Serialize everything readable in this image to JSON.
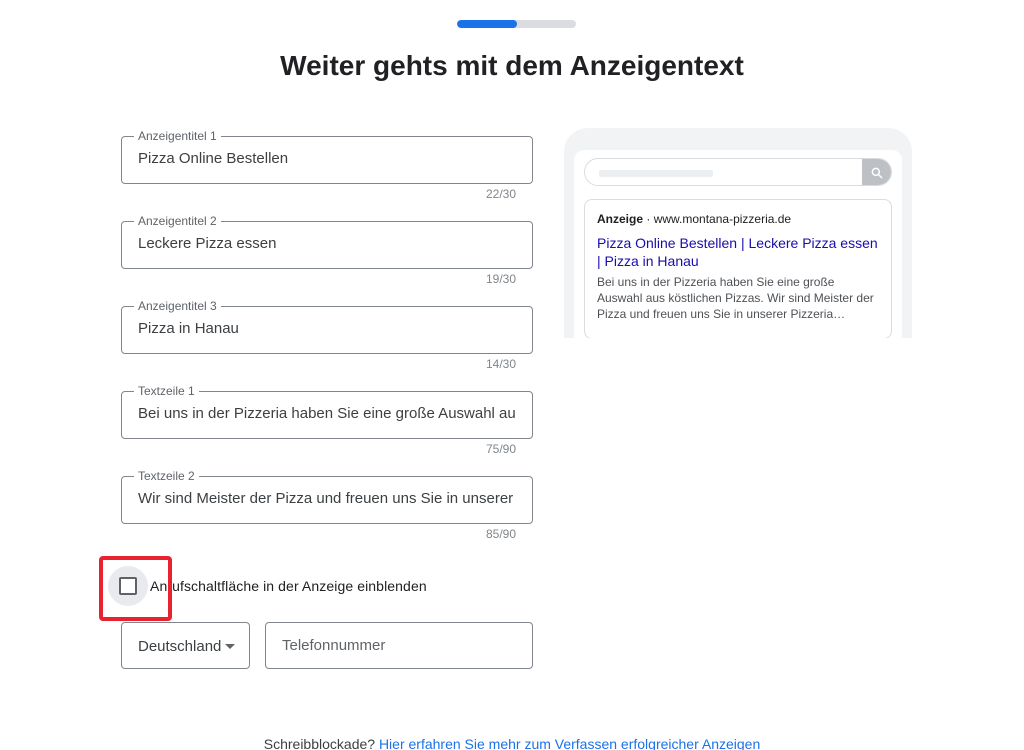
{
  "progress": {
    "value_percent": 50,
    "fill_color": "#1a73e8"
  },
  "title": "Weiter gehts mit dem Anzeigentext",
  "fields": [
    {
      "label": "Anzeigentitel 1",
      "value": "Pizza Online Bestellen",
      "counter": "22/30"
    },
    {
      "label": "Anzeigentitel 2",
      "value": "Leckere Pizza essen",
      "counter": "19/30"
    },
    {
      "label": "Anzeigentitel 3",
      "value": "Pizza in Hanau",
      "counter": "14/30"
    },
    {
      "label": "Textzeile 1",
      "value": "Bei uns in der Pizzeria haben Sie eine große Auswahl aus köstlichen Pizzas.",
      "counter": "75/90"
    },
    {
      "label": "Textzeile 2",
      "value": "Wir sind Meister der Pizza und freuen uns Sie in unserer Pizzeria begrüßen zu dürfen.",
      "counter": "85/90"
    }
  ],
  "call_button": {
    "label": "Anrufschaltfläche in der Anzeige einblenden",
    "checked": false
  },
  "country": {
    "value": "Deutschland"
  },
  "phone": {
    "placeholder": "Telefonnummer"
  },
  "preview": {
    "ad_label": "Anzeige",
    "separator": "·",
    "url": "www.montana-pizzeria.de",
    "headline": "Pizza Online Bestellen | Leckere Pizza essen | Pizza in Hanau",
    "description": "Bei uns in der Pizzeria haben Sie eine große Auswahl aus köstlichen Pizzas. Wir sind Meister der Pizza und freuen uns Sie in unserer Pizzeria begrüßen zu dürfen.",
    "search_icon": "search-icon"
  },
  "footer": {
    "text": "Schreibblockade?",
    "link": "Hier erfahren Sie mehr zum Verfassen erfolgreicher Anzeigen"
  }
}
